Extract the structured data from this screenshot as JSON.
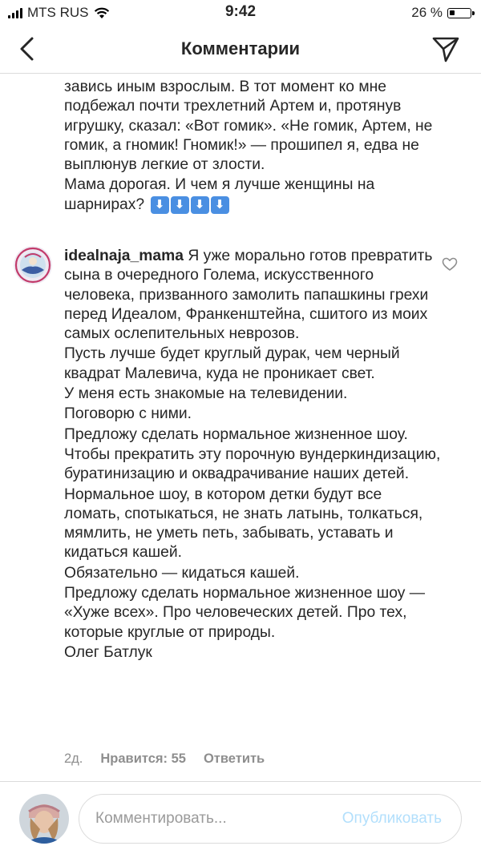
{
  "status_bar": {
    "carrier": "MTS RUS",
    "time": "9:42",
    "battery": "26 %",
    "battery_level": 0.26
  },
  "header": {
    "title": "Комментарии",
    "back_icon": "chevron-left-icon",
    "send_icon": "paper-plane-icon"
  },
  "previous_comment": {
    "paragraphs": [
      "завись иным взрослым. В тот момент ко мне подбежал почти трехлетний Артем и, протянув игрушку, сказал: «Вот гомик». «Не гомик, Артем, не гомик, а гномик! Гномик!» — прошипел я, едва не выплюнув легкие от злости.",
      "Мама дорогая. И чем я лучше женщины на шарнирах?"
    ],
    "emoji": "⬇⬇⬇⬇"
  },
  "comment": {
    "username": "idealnaja_mama",
    "paragraphs": [
      "Я уже морально готов превратить сына в очередного Голема, искусственного человека, призванного замолить папашкины грехи перед Идеалом, Франкенштейна, сшитого из моих самых ослепительных неврозов.",
      "Пусть лучше будет круглый дурак, чем черный квадрат Малевича, куда не проникает свет.",
      "У меня есть знакомые на телевидении.",
      "Поговорю с ними.",
      "Предложу сделать нормальное жизненное шоу.",
      "Чтобы прекратить эту порочную вундеркиндизацию, буратинизацию и оквадрачивание наших детей.",
      "Нормальное шоу, в котором детки будут все ломать, спотыкаться, не знать латынь, толкаться, мямлить, не уметь петь, забывать, уставать и кидаться кашей.",
      "Обязательно — кидаться кашей.",
      "Предложу сделать нормальное жизненное шоу — «Хуже всех». Про человеческих детей. Про тех, которые круглые от природы.",
      "Олег Батлук"
    ],
    "time_ago": "2д.",
    "likes": "Нравится: 55",
    "reply": "Ответить",
    "like_icon": "heart-outline-icon"
  },
  "composer": {
    "placeholder": "Комментировать...",
    "publish": "Опубликовать"
  },
  "colors": {
    "text": "#262626",
    "meta": "#8e8e8e",
    "publish_disabled": "#b2dffc",
    "divider": "#dbdbdb"
  }
}
